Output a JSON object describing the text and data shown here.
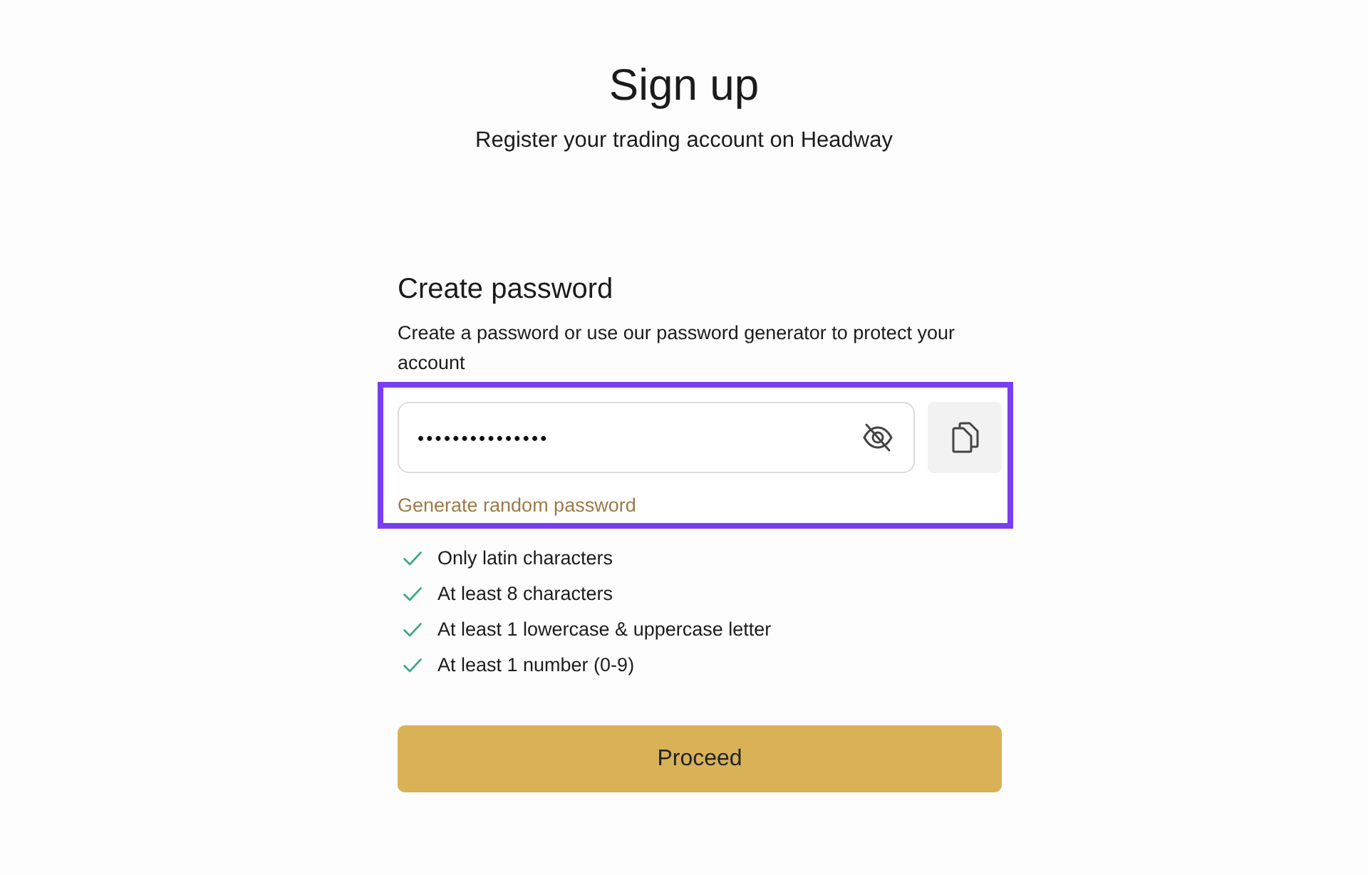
{
  "header": {
    "title": "Sign up",
    "subtitle": "Register your trading account on Headway"
  },
  "form": {
    "heading": "Create password",
    "description": "Create a password or use our password generator to protect your account"
  },
  "password": {
    "value": "•••••••••••••••",
    "hidden": true
  },
  "generate_link": "Generate random password",
  "requirements": [
    {
      "label": "Only latin characters",
      "met": true
    },
    {
      "label": "At least 8 characters",
      "met": true
    },
    {
      "label": "At least 1 lowercase & uppercase letter",
      "met": true
    },
    {
      "label": "At least 1 number (0-9)",
      "met": true
    }
  ],
  "button": {
    "label": "Proceed",
    "disabled": false
  }
}
